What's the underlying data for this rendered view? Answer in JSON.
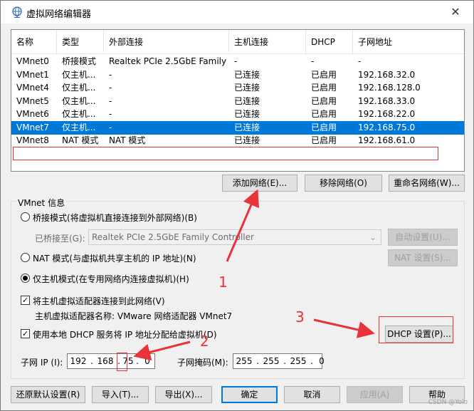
{
  "window": {
    "title": "虚拟网络编辑器",
    "close_glyph": "✕"
  },
  "table": {
    "headers": [
      "名称",
      "类型",
      "外部连接",
      "主机连接",
      "DHCP",
      "子网地址"
    ],
    "rows": [
      [
        "VMnet0",
        "桥接模式",
        "Realtek PCIe 2.5GbE Family ...",
        "-",
        "-",
        "-"
      ],
      [
        "VMnet1",
        "仅主机...",
        "-",
        "已连接",
        "已启用",
        "192.168.32.0"
      ],
      [
        "VMnet4",
        "仅主机...",
        "-",
        "已连接",
        "已启用",
        "192.168.128.0"
      ],
      [
        "VMnet5",
        "仅主机...",
        "-",
        "已连接",
        "已启用",
        "192.168.33.0"
      ],
      [
        "VMnet6",
        "仅主机...",
        "-",
        "已连接",
        "已启用",
        "192.168.22.0"
      ],
      [
        "VMnet7",
        "仅主机...",
        "-",
        "已连接",
        "已启用",
        "192.168.75.0"
      ],
      [
        "VMnet8",
        "NAT 模式",
        "NAT 模式",
        "已连接",
        "已启用",
        "192.168.61.0"
      ]
    ],
    "selected_row": "VMnet7"
  },
  "list_buttons": {
    "add": "添加网络(E)...",
    "remove": "移除网络(O)",
    "rename": "重命名网络(W)..."
  },
  "vmnet_info": {
    "group_title": "VMnet 信息",
    "bridge_label": "桥接模式(将虚拟机直接连接到外部网络)(B)",
    "bridged_to_label": "已桥接至(G):",
    "bridged_to_value": "Realtek PCIe 2.5GbE Family Controller",
    "auto_settings": "自动设置(U)...",
    "nat_label": "NAT 模式(与虚拟机共享主机的 IP 地址)(N)",
    "nat_settings": "NAT 设置(S)...",
    "hostonly_label": "仅主机模式(在专用网络内连接虚拟机)(H)",
    "selected_mode": "hostonly",
    "connect_adapter_label": "将主机虚拟适配器连接到此网络(V)",
    "adapter_name_label": "主机虚拟适配器名称: VMware 网络适配器 VMnet7",
    "dhcp_label": "使用本地 DHCP 服务将 IP 地址分配给虚拟机(D)",
    "dhcp_settings": "DHCP 设置(P)...",
    "subnet_ip_label": "子网 IP (I):",
    "subnet_ip": [
      "192",
      "168",
      "75",
      "0"
    ],
    "subnet_mask_label": "子网掩码(M):",
    "subnet_mask": [
      "255",
      "255",
      "255",
      "0"
    ]
  },
  "footer_buttons": {
    "restore": "还原默认设置(R)",
    "import": "导入(T)...",
    "export": "导出(X)...",
    "ok": "确定",
    "cancel": "取消",
    "apply": "应用(A)",
    "help": "帮助"
  },
  "annotations": {
    "n1": "1",
    "n2": "2",
    "n3": "3",
    "color": "#e8333a"
  },
  "watermark": "CSDN @Yolo"
}
